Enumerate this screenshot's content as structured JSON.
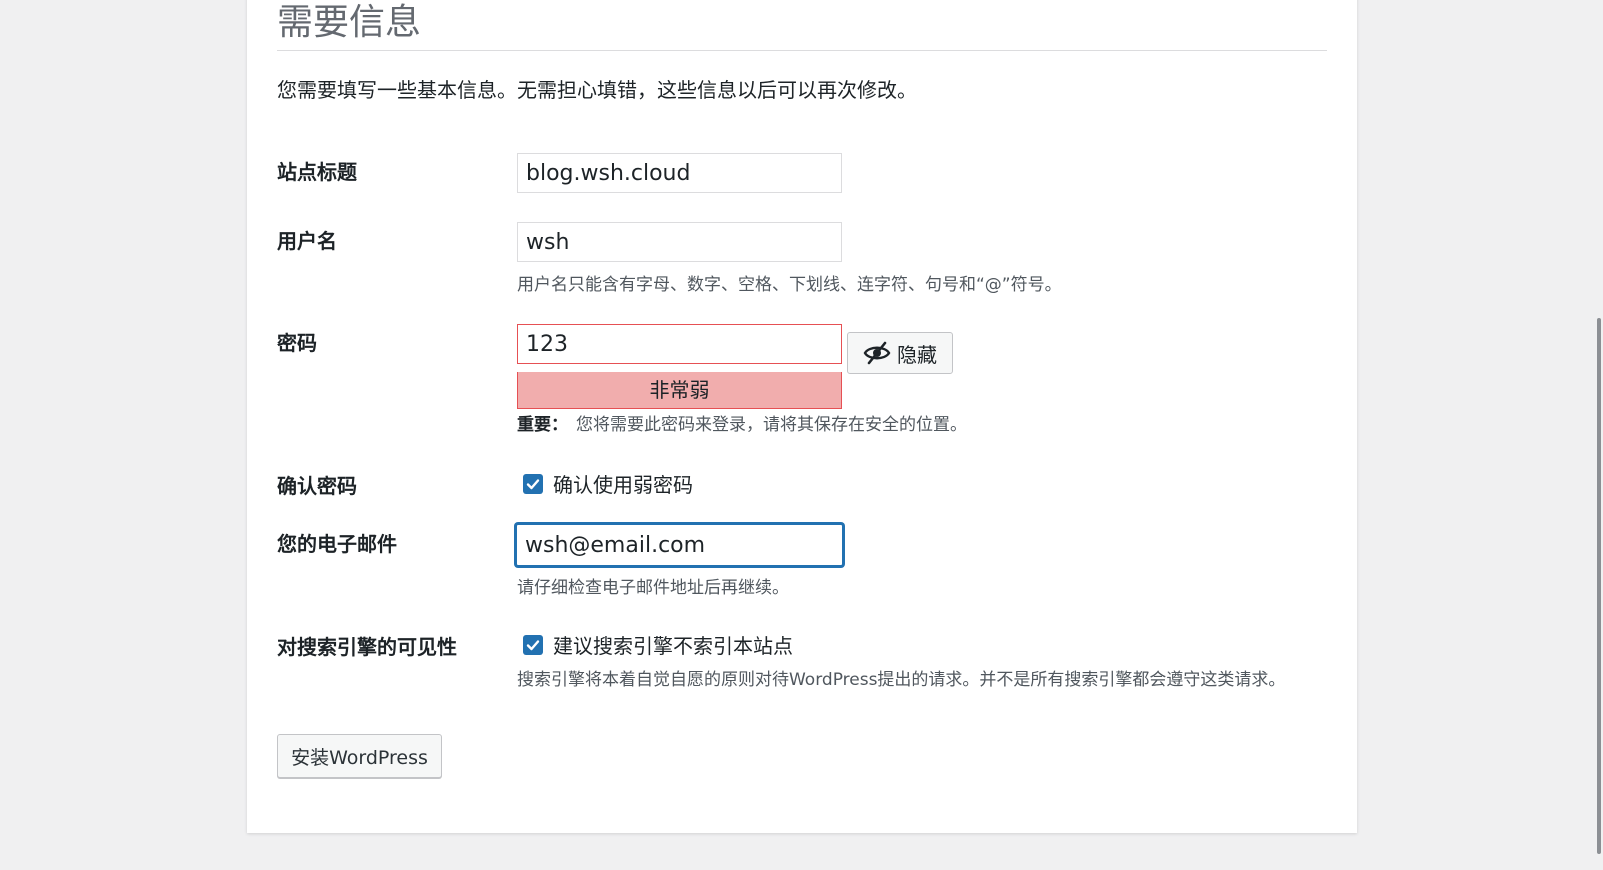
{
  "heading": "需要信息",
  "intro": "您需要填写一些基本信息。无需担心填错，这些信息以后可以再次修改。",
  "site_title": {
    "label": "站点标题",
    "value": "blog.wsh.cloud"
  },
  "username": {
    "label": "用户名",
    "value": "wsh",
    "hint": "用户名只能含有字母、数字、空格、下划线、连字符、句号和“@”符号。"
  },
  "password": {
    "label": "密码",
    "value": "123",
    "strength": "非常弱",
    "toggle_label": "隐藏",
    "toggle_icon": "eye-slash-icon",
    "note_strong": "重要：",
    "note": "您将需要此密码来登录，请将其保存在安全的位置。",
    "strength_color": "#f1adad",
    "error_border_color": "#e65054"
  },
  "confirm_password": {
    "label": "确认密码",
    "checkbox_label": "确认使用弱密码",
    "checked": true
  },
  "email": {
    "label": "您的电子邮件",
    "value": "wsh@email.com",
    "hint": "请仔细检查电子邮件地址后再继续。"
  },
  "search_visibility": {
    "label": "对搜索引擎的可见性",
    "checkbox_label": "建议搜索引擎不索引本站点",
    "checked": true,
    "hint": "搜索引擎将本着自觉自愿的原则对待WordPress提出的请求。并不是所有搜索引擎都会遵守这类请求。"
  },
  "submit": {
    "label": "安装WordPress"
  },
  "colors": {
    "accent": "#2271b1",
    "background": "#f0f0f1",
    "card": "#ffffff"
  }
}
